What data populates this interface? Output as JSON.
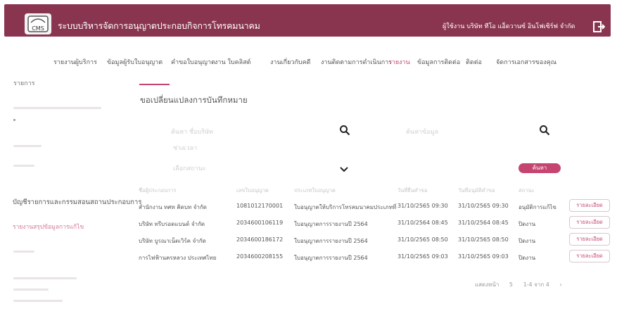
{
  "header": {
    "logo_text": "CMS",
    "app_title": "ระบบบริหารจัดการอนุญาตประกอบกิจการโทรคมนาคม",
    "user_name": "ผู้ใช้งาน บริษัท ทีโอ แอ็ดวานซ์ อินโฟเซิร์ฟ จำกัด"
  },
  "nav": {
    "items": [
      {
        "label": "รายงานผู้บริการ"
      },
      {
        "label": "ข้อมูลผู้รับใบอนุญาต"
      },
      {
        "label": "คำขอใบอนุญาต"
      },
      {
        "label": "งาน ใบคลิสต์"
      },
      {
        "label": "งานเกี่ยวกับคดี"
      },
      {
        "label": "งานติดตามการดำเนินการ"
      },
      {
        "label": "รายงาน"
      },
      {
        "label": "ข้อมูลการติดต่อ"
      },
      {
        "label": "ติดต่อ"
      },
      {
        "label": "จัดการเอกสารของคุณ"
      }
    ],
    "active_index": 6
  },
  "sidebar": {
    "heading": "รายการ",
    "active_item": "บัญชีรายการและกรรมสอนสถานประกอบการ",
    "sub_item": "รายงานสรุปข้อมูลการแก้ไข"
  },
  "page": {
    "title": "ขอเปลี่ยนแปลงการบันทึกหมาย"
  },
  "filters": {
    "field1_placeholder": "ค้นหา ชื่อบริษัท",
    "field2_placeholder": "ค้นหาข้อมูล",
    "field3_placeholder": "ช่วงเวลา",
    "field4_placeholder": "เลือกสถานะ",
    "search_label": "ค้นหา"
  },
  "table": {
    "columns": [
      "ชื่อผู้ประกอบการ",
      "เลขใบอนุญาต",
      "ประเภทใบอนุญาต",
      "วันที่ยื่นคำขอ",
      "วันที่อนุมัติคำขอ",
      "สถานะ"
    ],
    "rows": [
      {
        "company": "สำนักงาน ทศท คิดบท จำกัด",
        "license_no": "1081012170001",
        "license_type": "ใบอนุญาตให้บริการโทรคมนาคมประเภทที่",
        "submitted": "31/10/2565 09:30",
        "approved": "31/10/2565 09:30",
        "status": "อนุมัติการแก้ไข",
        "action": "รายละเอียด"
      },
      {
        "company": "บริษัท ทรีบรอดแบนด์ จำกัด",
        "license_no": "2034600106119",
        "license_type": "ใบอนุญาตการรายงานปี 2564",
        "submitted": "31/10/2564 08:45",
        "approved": "31/10/2564 08:45",
        "status": "ปิดงาน",
        "action": "รายละเอียด"
      },
      {
        "company": "บริษัท บูรณาเน็ตเวิร์ค จำกัด",
        "license_no": "2034600186172",
        "license_type": "ใบอนุญาตการรายงานปี 2564",
        "submitted": "31/10/2565 08:50",
        "approved": "31/10/2565 08:50",
        "status": "ปิดงาน",
        "action": "รายละเอียด"
      },
      {
        "company": "การไฟฟ้านครหลวง ประเทศไทย",
        "license_no": "2034600208155",
        "license_type": "ใบอนุญาตการรายงานปี 2564",
        "submitted": "31/10/2565 09:03",
        "approved": "31/10/2565 09:03",
        "status": "ปิดงาน",
        "action": "รายละเอียด"
      }
    ]
  },
  "pager": {
    "rows_label": "แสดงหน้า",
    "page_value": "5",
    "range_label": "1-4 จาก 4"
  },
  "icons": {
    "search": "search-icon",
    "dropdown": "chevron-down-icon",
    "logout": "logout-icon"
  },
  "colors": {
    "brand": "#8a3550",
    "accent": "#c64570"
  }
}
